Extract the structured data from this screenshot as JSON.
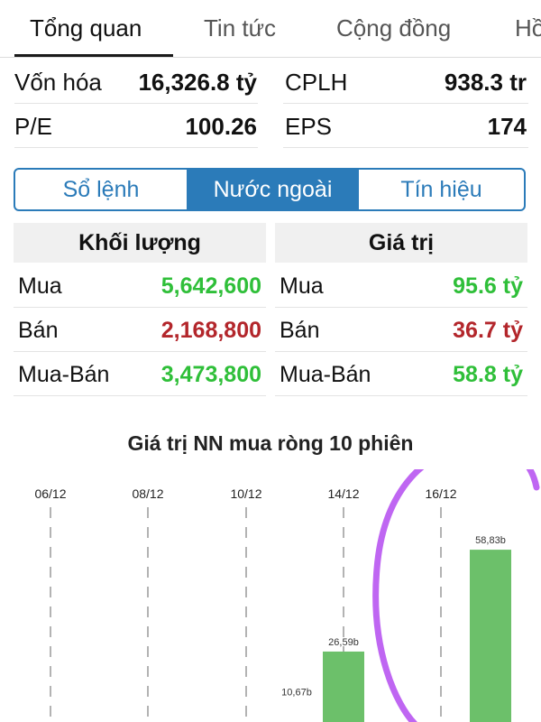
{
  "tabs": [
    "Tổng quan",
    "Tin tức",
    "Cộng đồng",
    "Hồ"
  ],
  "stats": {
    "von_hoa_label": "Vốn hóa",
    "von_hoa_value": "16,326.8 tỷ",
    "cplh_label": "CPLH",
    "cplh_value": "938.3 tr",
    "pe_label": "P/E",
    "pe_value": "100.26",
    "eps_label": "EPS",
    "eps_value": "174"
  },
  "segments": [
    "Sổ lệnh",
    "Nước ngoài",
    "Tín hiệu"
  ],
  "segments_active": "Nước ngoài",
  "foreign": {
    "volume": {
      "header": "Khối lượng",
      "rows": [
        {
          "label": "Mua",
          "value": "5,642,600"
        },
        {
          "label": "Bán",
          "value": "2,168,800"
        },
        {
          "label": "Mua-Bán",
          "value": "3,473,800"
        }
      ]
    },
    "value": {
      "header": "Giá trị",
      "rows": [
        {
          "label": "Mua",
          "value": "95.6 tỷ"
        },
        {
          "label": "Bán",
          "value": "36.7 tỷ"
        },
        {
          "label": "Mua-Bán",
          "value": "58.8 tỷ"
        }
      ]
    }
  },
  "colors": {
    "accent": "#2b7bb9",
    "positive": "#2fbf39",
    "negative": "#b3262b",
    "bar": "#6cc06a",
    "annotation_circle": "#b44bf0"
  },
  "chart_data": {
    "type": "bar",
    "title": "Giá trị NN mua ròng 10 phiên",
    "x_tick_labels": [
      "06/12",
      "08/12",
      "10/12",
      "14/12",
      "16/12"
    ],
    "bars": [
      {
        "label": "10,67b",
        "value": 10.67
      },
      {
        "label": "26,59b",
        "value": 26.59
      },
      {
        "label": "58,83b",
        "value": 58.83
      }
    ],
    "unit": "b",
    "grid": "dashed vertical"
  }
}
